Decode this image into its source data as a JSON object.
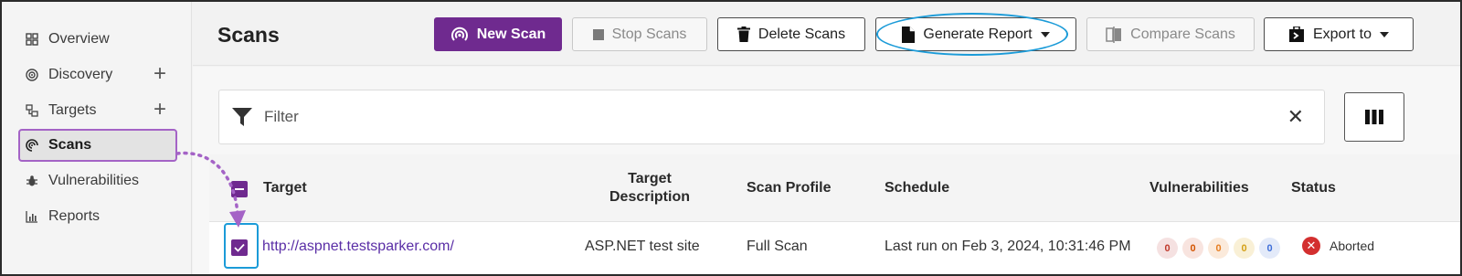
{
  "sidebar": {
    "items": [
      {
        "label": "Overview",
        "icon": "grid-icon",
        "plus": false,
        "active": false
      },
      {
        "label": "Discovery",
        "icon": "target-circle-icon",
        "plus": true,
        "active": false
      },
      {
        "label": "Targets",
        "icon": "targets-tree-icon",
        "plus": true,
        "active": false
      },
      {
        "label": "Scans",
        "icon": "scan-signal-icon",
        "plus": false,
        "active": true
      },
      {
        "label": "Vulnerabilities",
        "icon": "bug-icon",
        "plus": false,
        "active": false
      },
      {
        "label": "Reports",
        "icon": "bar-chart-icon",
        "plus": false,
        "active": false
      }
    ],
    "plus_symbol": "+"
  },
  "header": {
    "title": "Scans",
    "buttons": {
      "new_scan": "New Scan",
      "stop_scans": "Stop Scans",
      "delete_scans": "Delete Scans",
      "generate_report": "Generate Report",
      "compare_scans": "Compare Scans",
      "export_to": "Export to"
    }
  },
  "filter": {
    "placeholder": "Filter",
    "clear_symbol": "✕"
  },
  "table": {
    "columns": {
      "target": "Target",
      "target_description_line1": "Target",
      "target_description_line2": "Description",
      "scan_profile": "Scan Profile",
      "schedule": "Schedule",
      "vulnerabilities": "Vulnerabilities",
      "status": "Status"
    },
    "rows": [
      {
        "target": "http://aspnet.testsparker.com/",
        "description": "ASP.NET test site",
        "profile": "Full Scan",
        "schedule": "Last run on Feb 3, 2024, 10:31:46 PM",
        "vulns": [
          "0",
          "0",
          "0",
          "0",
          "0"
        ],
        "status": "Aborted"
      }
    ]
  },
  "colors": {
    "accent": "#6f2a8f",
    "highlight": "#1b9bd8",
    "active_border": "#a463c6",
    "vuln_critical": "#c0392b",
    "vuln_high": "#d35400",
    "vuln_medium": "#e67e22",
    "vuln_low": "#d4a017",
    "vuln_info": "#3f6fd8"
  }
}
